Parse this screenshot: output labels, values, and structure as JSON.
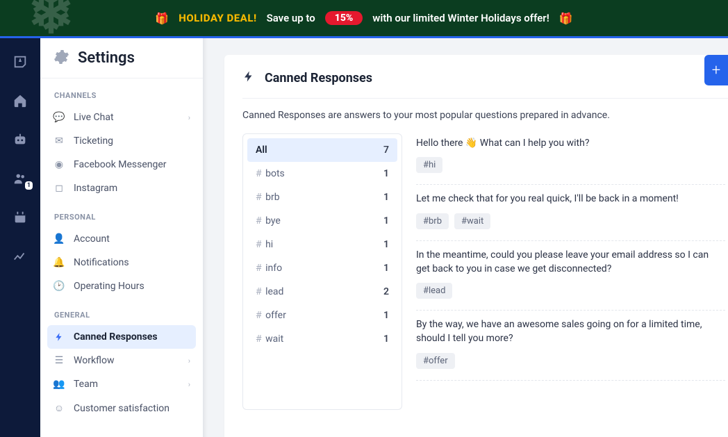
{
  "banner": {
    "deal": "HOLIDAY DEAL!",
    "save": "Save up to",
    "pct": "15%",
    "rest": "with our limited Winter Holidays offer!"
  },
  "settings": {
    "title": "Settings",
    "sections": {
      "channels": {
        "label": "CHANNELS",
        "items": [
          {
            "label": "Live Chat",
            "icon": "chat",
            "expandable": true
          },
          {
            "label": "Ticketing",
            "icon": "mail"
          },
          {
            "label": "Facebook Messenger",
            "icon": "messenger"
          },
          {
            "label": "Instagram",
            "icon": "instagram"
          }
        ]
      },
      "personal": {
        "label": "PERSONAL",
        "items": [
          {
            "label": "Account",
            "icon": "user"
          },
          {
            "label": "Notifications",
            "icon": "bell"
          },
          {
            "label": "Operating Hours",
            "icon": "clock"
          }
        ]
      },
      "general": {
        "label": "GENERAL",
        "items": [
          {
            "label": "Canned Responses",
            "icon": "bolt",
            "active": true
          },
          {
            "label": "Workflow",
            "icon": "list",
            "expandable": true
          },
          {
            "label": "Team",
            "icon": "team",
            "expandable": true
          },
          {
            "label": "Customer satisfaction",
            "icon": "smile"
          }
        ]
      }
    }
  },
  "content": {
    "heading": "Canned Responses",
    "description": "Canned Responses are answers to your most popular questions prepared in advance.",
    "tags": [
      {
        "label": "All",
        "count": "7",
        "active": true,
        "nohash": true
      },
      {
        "label": "bots",
        "count": "1"
      },
      {
        "label": "brb",
        "count": "1"
      },
      {
        "label": "bye",
        "count": "1"
      },
      {
        "label": "hi",
        "count": "1"
      },
      {
        "label": "info",
        "count": "1"
      },
      {
        "label": "lead",
        "count": "2"
      },
      {
        "label": "offer",
        "count": "1"
      },
      {
        "label": "wait",
        "count": "1"
      }
    ],
    "responses": [
      {
        "text": "Hello there 👋 What can I help you with?",
        "chips": [
          "#hi"
        ]
      },
      {
        "text": "Let me check that for you real quick, I'll be back in a moment!",
        "chips": [
          "#brb",
          "#wait"
        ]
      },
      {
        "text": "In the meantime, could you please leave your email address so I can get back to you in case we get disconnected?",
        "chips": [
          "#lead"
        ]
      },
      {
        "text": "By the way, we have an awesome sales going on for a limited time, should I tell you more?",
        "chips": [
          "#offer"
        ]
      }
    ]
  },
  "rail": {
    "contacts_badge": "1"
  }
}
